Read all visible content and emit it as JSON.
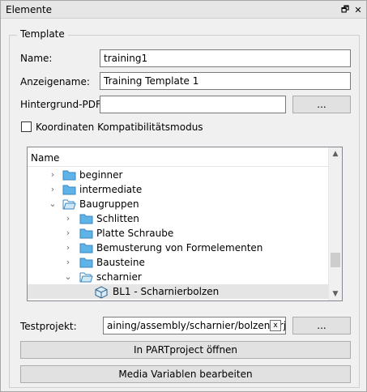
{
  "window": {
    "title": "Elemente",
    "restore_glyph": "🗗",
    "close_glyph": "✕"
  },
  "template_group": {
    "label": "Template"
  },
  "name_row": {
    "label": "Name:",
    "value": "training1"
  },
  "display_row": {
    "label": "Anzeigename:",
    "value": "Training Template 1"
  },
  "pdf_row": {
    "label": "Hintergrund-PDF:",
    "value": "",
    "browse_label": "..."
  },
  "compat": {
    "label": "Koordinaten Kompatibilitätsmodus",
    "checked": false
  },
  "tree": {
    "header": "Name",
    "items": [
      {
        "label": "beginner",
        "expanded": false
      },
      {
        "label": "intermediate",
        "expanded": false
      },
      {
        "label": "Baugruppen",
        "expanded": true
      },
      {
        "label": "Schlitten",
        "expanded": false
      },
      {
        "label": "Platte Schraube",
        "expanded": false
      },
      {
        "label": "Bemusterung von Formelementen",
        "expanded": false
      },
      {
        "label": "Bausteine",
        "expanded": false
      },
      {
        "label": "scharnier",
        "expanded": true
      },
      {
        "label": "BL1 - Scharnierbolzen",
        "selected": true
      }
    ]
  },
  "test_project": {
    "label": "Testprojekt:",
    "value": "aining/assembly/scharnier/bolzen.prj",
    "clear_label": "x",
    "browse_label": "..."
  },
  "actions": {
    "open_label": "In PARTproject öffnen",
    "media_label": "Media Variablen bearbeiten"
  }
}
